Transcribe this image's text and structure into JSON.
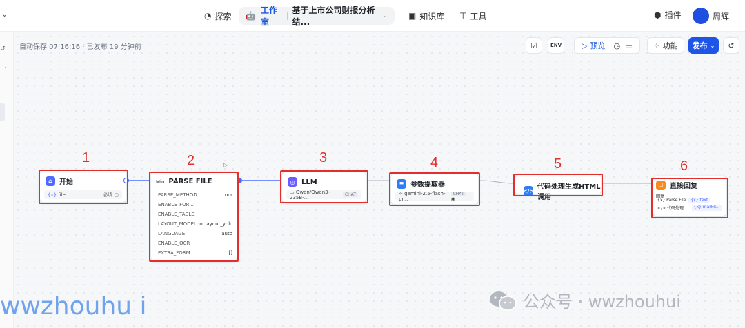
{
  "topbar": {
    "explore": "探索",
    "studio": "工作室",
    "project": "基于上市公司财报分析结...",
    "knowledge": "知识库",
    "tools": "工具",
    "plugins": "插件",
    "user": "周辉"
  },
  "canvas": {
    "autosave": "自动保存 07:16:16 · 已发布 19 分钟前"
  },
  "toolbar": {
    "env": "ENV",
    "preview": "预览",
    "features": "功能",
    "publish": "发布"
  },
  "nodes": {
    "start": {
      "title": "开始",
      "param": "file",
      "required": "必填"
    },
    "parse": {
      "prefix": "Min",
      "title": "PARSE FILE",
      "params": [
        {
          "key": "PARSE_METHOD",
          "value": "ocr"
        },
        {
          "key": "ENABLE_FOR...",
          "value": ""
        },
        {
          "key": "ENABLE_TABLE",
          "value": ""
        },
        {
          "key": "LAYOUT_MODEL",
          "value": "doclayout_yolo"
        },
        {
          "key": "LANGUAGE",
          "value": "auto"
        },
        {
          "key": "ENABLE_OCR",
          "value": ""
        },
        {
          "key": "EXTRA_FORM...",
          "value": "[]"
        }
      ]
    },
    "llm": {
      "title": "LLM",
      "model": "Qwen/Qwen3-235B-...",
      "tag": "CHAT"
    },
    "extractor": {
      "title": "参数提取器",
      "model": "gemini-2.5-flash-pr...",
      "tag": "CHAT"
    },
    "code": {
      "title": "代码处理生成HTML调用"
    },
    "reply": {
      "title": "直接回复",
      "label": "回复",
      "rows": [
        {
          "source": "Parse File",
          "var": "text"
        },
        {
          "source": "代码处理 ...",
          "var": "markd..."
        }
      ]
    }
  },
  "annotations": [
    "1",
    "2",
    "3",
    "4",
    "5",
    "6"
  ],
  "watermark": {
    "left": "wwzhouhu i",
    "right": "公众号 · wwzhouhui"
  },
  "colors": {
    "accent": "#1f55e6",
    "annotation": "#e42d2d",
    "watermark_left": "#6fa4ec"
  }
}
